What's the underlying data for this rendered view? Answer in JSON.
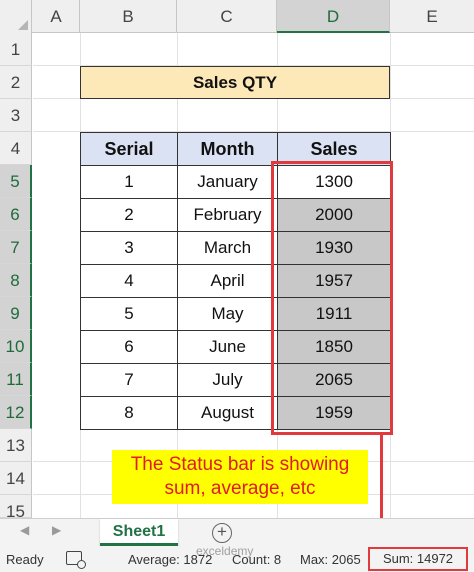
{
  "columns": [
    "A",
    "B",
    "C",
    "D",
    "E"
  ],
  "rows": [
    "1",
    "2",
    "3",
    "4",
    "5",
    "6",
    "7",
    "8",
    "9",
    "10",
    "11",
    "12",
    "13",
    "14",
    "15"
  ],
  "title": "Sales QTY",
  "table": {
    "headers": [
      "Serial",
      "Month",
      "Sales"
    ],
    "rows": [
      {
        "serial": "1",
        "month": "January",
        "sales": "1300"
      },
      {
        "serial": "2",
        "month": "February",
        "sales": "2000"
      },
      {
        "serial": "3",
        "month": "March",
        "sales": "1930"
      },
      {
        "serial": "4",
        "month": "April",
        "sales": "1957"
      },
      {
        "serial": "5",
        "month": "May",
        "sales": "1911"
      },
      {
        "serial": "6",
        "month": "June",
        "sales": "1850"
      },
      {
        "serial": "7",
        "month": "July",
        "sales": "2065"
      },
      {
        "serial": "8",
        "month": "August",
        "sales": "1959"
      }
    ]
  },
  "callout": {
    "line1": "The Status bar is showing",
    "line2": "sum, average, etc"
  },
  "sheet_tab": "Sheet1",
  "add_sheet_icon": "+",
  "nav_prev": "◀",
  "nav_next": "▶",
  "watermark": "exceldemy",
  "status": {
    "ready": "Ready",
    "average": "Average: 1872",
    "count": "Count: 8",
    "max": "Max: 2065",
    "sum": "Sum: 14972"
  },
  "colors": {
    "selection_green": "#217346",
    "highlight_red": "#e0393e",
    "title_fill": "#fde9b8",
    "header_fill": "#dbe2f3",
    "callout_fill": "#ffff00"
  }
}
